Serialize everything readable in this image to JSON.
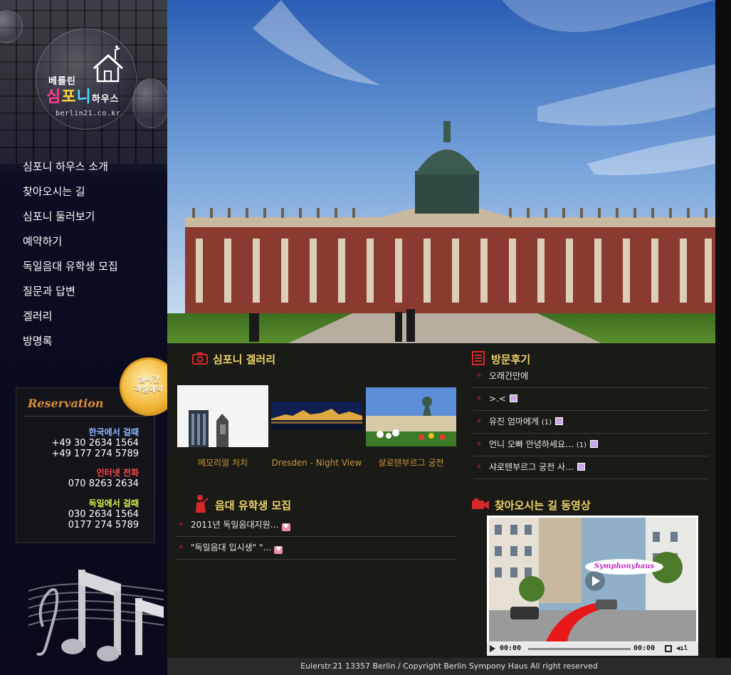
{
  "logo": {
    "top": "베를린",
    "main_1": "심",
    "main_2": "포",
    "main_3": "니",
    "main_4": "하우스",
    "url": "berlin21.co.kr"
  },
  "nav": {
    "items": [
      {
        "label": "심포니 하우스 소개"
      },
      {
        "label": "찾아오시는 길"
      },
      {
        "label": "심포니 둘러보기"
      },
      {
        "label": "예약하기"
      },
      {
        "label": "독일음대 유학생 모집"
      },
      {
        "label": "질문과 답변"
      },
      {
        "label": "겔러리"
      },
      {
        "label": "방명록"
      }
    ]
  },
  "badge": {
    "line1": "실시간",
    "line2": "객실예약"
  },
  "reservation": {
    "title": "Reservation",
    "korea_label": "한국에서 걸때",
    "korea_num1": "+49 30 2634 1564",
    "korea_num2": "+49 177 274 5789",
    "internet_label": "인터넷 전화",
    "internet_num": "070 8263 2634",
    "germany_label": "독일에서 걸때",
    "germany_num1": "030 2634 1564",
    "germany_num2": "0177 274 5789"
  },
  "colors": {
    "korea_label": "#8fb6ff",
    "internet_label": "#ff4a4a",
    "germany_label": "#d6f04a",
    "section_title": "#f0d56a",
    "caption": "#c8963c"
  },
  "gallery": {
    "title": "심포니 겔러리",
    "icon": "camera-icon",
    "items": [
      {
        "caption": "메모리얼 처치"
      },
      {
        "caption": "Dresden - Night View"
      },
      {
        "caption": "샬로텐부르그 궁전"
      }
    ]
  },
  "reviews": {
    "title": "방문후기",
    "icon": "document-icon",
    "items": [
      {
        "text": "오래간만에",
        "count": "",
        "lock": false
      },
      {
        "text": ">.<",
        "count": "",
        "lock": true
      },
      {
        "text": "유진 엄마에게",
        "count": "(1)",
        "lock": true
      },
      {
        "text": "언니 오빠 안녕하세요…",
        "count": "(1)",
        "lock": true
      },
      {
        "text": "샤로텐부르그 궁전 사…",
        "count": "",
        "lock": true
      }
    ]
  },
  "recruit": {
    "title": "음대 유학생 모집",
    "icon": "musician-icon",
    "items": [
      {
        "text": "2011년 독일음대지원…"
      },
      {
        "text": "\"독일음대 입시생\" \"…"
      }
    ]
  },
  "video": {
    "title": "찾아오시는 길 동영상",
    "icon": "camera-video-icon",
    "label": "Symphonyhaus",
    "time_current": "00:00",
    "time_total": "00:00"
  },
  "footer": {
    "text": "Eulerstr.21 13357 Berlin / Copyright Berlin Sympony Haus All right reserved"
  }
}
